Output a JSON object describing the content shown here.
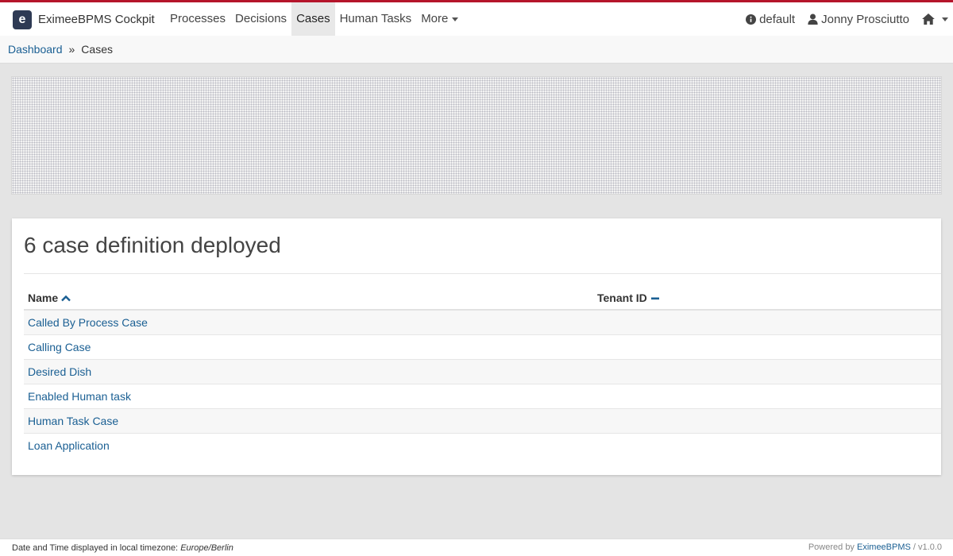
{
  "header": {
    "brand_logo": "e",
    "brand_name": "EximeeBPMS Cockpit",
    "nav": [
      {
        "label": "Processes"
      },
      {
        "label": "Decisions"
      },
      {
        "label": "Cases"
      },
      {
        "label": "Human Tasks"
      },
      {
        "label": "More"
      }
    ],
    "engine": "default",
    "user": "Jonny Prosciutto",
    "icons": {
      "info": "info-circle-icon",
      "user": "user-icon",
      "home": "home-icon"
    },
    "accent_color": "#b5152b"
  },
  "breadcrumb": {
    "home": "Dashboard",
    "separator": "»",
    "current": "Cases"
  },
  "card": {
    "title": "6 case definition deployed",
    "columns": {
      "name": "Name",
      "tenant": "Tenant ID"
    },
    "rows": [
      {
        "name": "Called By Process Case",
        "tenant": ""
      },
      {
        "name": "Calling Case",
        "tenant": ""
      },
      {
        "name": "Desired Dish",
        "tenant": ""
      },
      {
        "name": "Enabled Human task",
        "tenant": ""
      },
      {
        "name": "Human Task Case",
        "tenant": ""
      },
      {
        "name": "Loan Application",
        "tenant": ""
      }
    ]
  },
  "footer": {
    "timezone_prefix": "Date and Time displayed in local timezone:",
    "timezone": "Europe/Berlin",
    "powered_prefix": "Powered by",
    "powered_link": "EximeeBPMS",
    "version": "/ v1.0.0"
  },
  "colors": {
    "link": "#1a5f93",
    "brand_logo_bg": "#2e3a54"
  }
}
